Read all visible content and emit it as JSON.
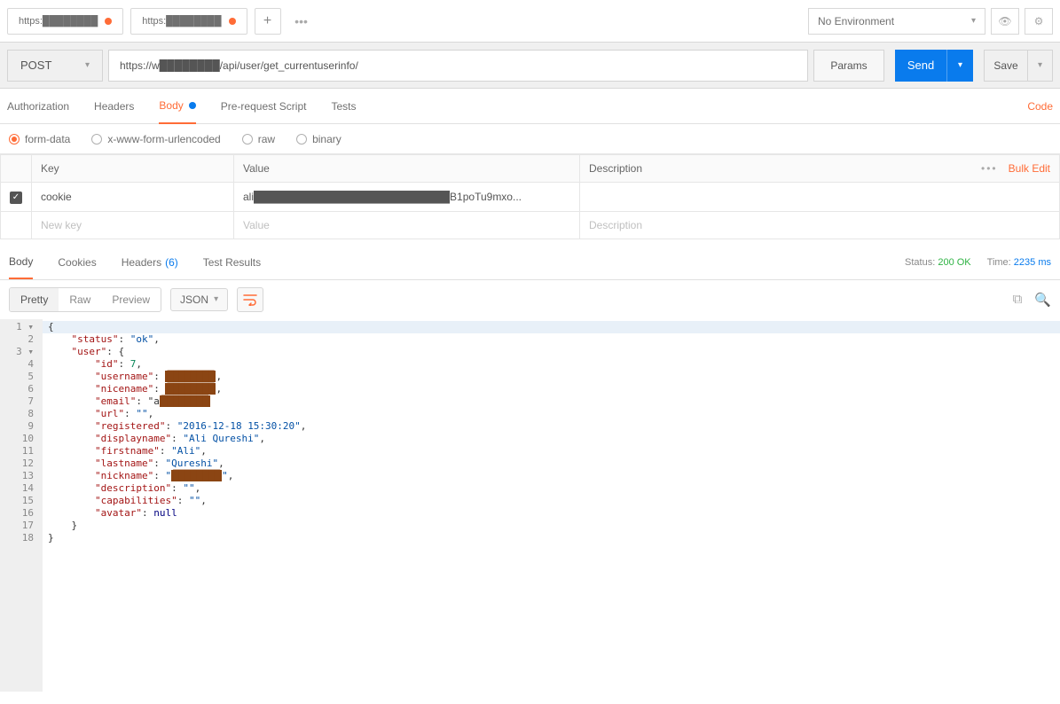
{
  "tabs": [
    {
      "label": "https:████████"
    },
    {
      "label": "https:████████"
    }
  ],
  "env": {
    "label": "No Environment"
  },
  "request": {
    "method": "POST",
    "url": "https://w████████/api/user/get_currentuserinfo/",
    "params_label": "Params",
    "send_label": "Send",
    "save_label": "Save"
  },
  "req_tabs": {
    "authorization": "Authorization",
    "headers": "Headers",
    "body": "Body",
    "prerequest": "Pre-request Script",
    "tests": "Tests",
    "code": "Code"
  },
  "body_types": {
    "formdata": "form-data",
    "urlencoded": "x-www-form-urlencoded",
    "raw": "raw",
    "binary": "binary"
  },
  "fd": {
    "headers": {
      "key": "Key",
      "value": "Value",
      "description": "Description"
    },
    "bulk_edit": "Bulk Edit",
    "rows": [
      {
        "checked": true,
        "key": "cookie",
        "value": "ali██████████████████████████B1poTu9mxo...",
        "description": ""
      }
    ],
    "placeholder": {
      "key": "New key",
      "value": "Value",
      "description": "Description"
    }
  },
  "resp_tabs": {
    "body": "Body",
    "cookies": "Cookies",
    "headers": "Headers",
    "headers_count": "(6)",
    "test_results": "Test Results"
  },
  "resp_meta": {
    "status_label": "Status:",
    "status_value": "200 OK",
    "time_label": "Time:",
    "time_value": "2235 ms"
  },
  "view": {
    "pretty": "Pretty",
    "raw": "Raw",
    "preview": "Preview",
    "format": "JSON"
  },
  "json_lines": [
    "{",
    "    \"status\": \"ok\",",
    "    \"user\": {",
    "        \"id\": 7,",
    "        \"username\": ████████,",
    "        \"nicename\": ████████,",
    "        \"email\": \"a████████",
    "        \"url\": \"\",",
    "        \"registered\": \"2016-12-18 15:30:20\",",
    "        \"displayname\": \"Ali Qureshi\",",
    "        \"firstname\": \"Ali\",",
    "        \"lastname\": \"Qureshi\",",
    "        \"nickname\": \"████████\",",
    "        \"description\": \"\",",
    "        \"capabilities\": \"\",",
    "        \"avatar\": null",
    "    }",
    "}"
  ]
}
